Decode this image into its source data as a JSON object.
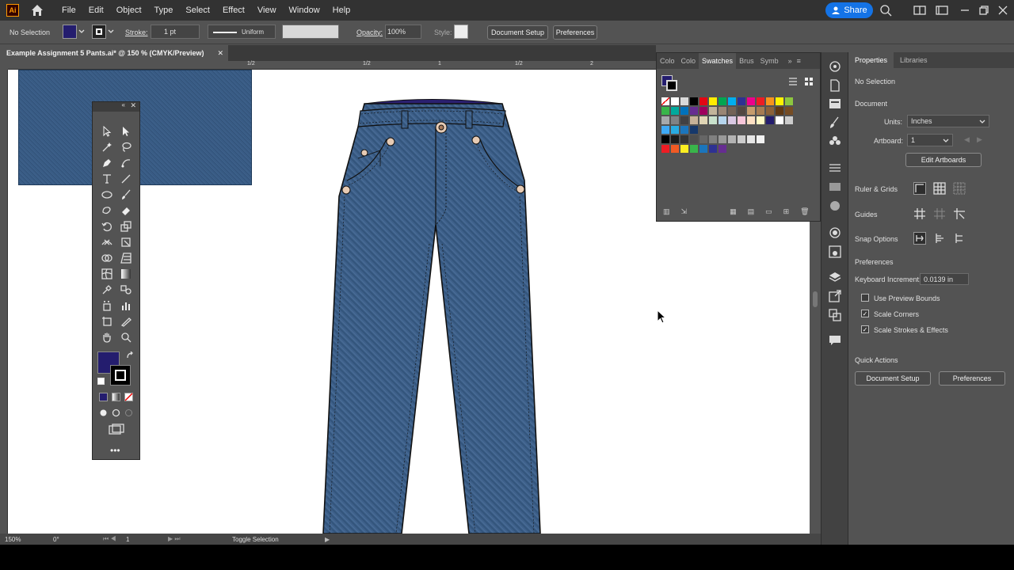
{
  "menubar": {
    "logo": "Ai",
    "items": [
      "File",
      "Edit",
      "Object",
      "Type",
      "Select",
      "Effect",
      "View",
      "Window",
      "Help"
    ],
    "share_label": "Share"
  },
  "control": {
    "selection": "No Selection",
    "stroke_label": "Stroke:",
    "stroke_value": "1 pt",
    "profile": "Uniform",
    "opacity_label": "Opacity:",
    "opacity_value": "100%",
    "style_label": "Style:",
    "document_setup": "Document Setup",
    "preferences": "Preferences"
  },
  "document": {
    "tab_title": "Example Assignment 5 Pants.ai* @ 150 % (CMYK/Preview)",
    "close": "✕",
    "ruler_marks": [
      "1/2",
      "1/2",
      "1",
      "1/2",
      "2"
    ]
  },
  "status": {
    "zoom": "150%",
    "rotation": "0°",
    "artboard": "1",
    "tool": "Toggle Selection"
  },
  "swatches": {
    "tabs": [
      "Colo",
      "Colo",
      "Swatches",
      "Brus",
      "Symb"
    ],
    "active_tab": "Swatches"
  },
  "colors": {
    "fill": "#241d6e",
    "denim": "#3a5d86",
    "accent": "#1473e6"
  },
  "properties": {
    "tabs": [
      "Properties",
      "Libraries"
    ],
    "selection": "No Selection",
    "document_heading": "Document",
    "units_label": "Units:",
    "units_value": "Inches",
    "artboard_label": "Artboard:",
    "artboard_value": "1",
    "edit_artboards": "Edit Artboards",
    "ruler_grids": "Ruler & Grids",
    "guides": "Guides",
    "snap_options": "Snap Options",
    "preferences_heading": "Preferences",
    "keyboard_increment_label": "Keyboard Increment:",
    "keyboard_increment_value": "0.0139 in",
    "use_preview_bounds": "Use Preview Bounds",
    "scale_corners": "Scale Corners",
    "scale_strokes": "Scale Strokes & Effects",
    "quick_actions": "Quick Actions",
    "document_setup": "Document Setup",
    "preferences_button": "Preferences"
  }
}
